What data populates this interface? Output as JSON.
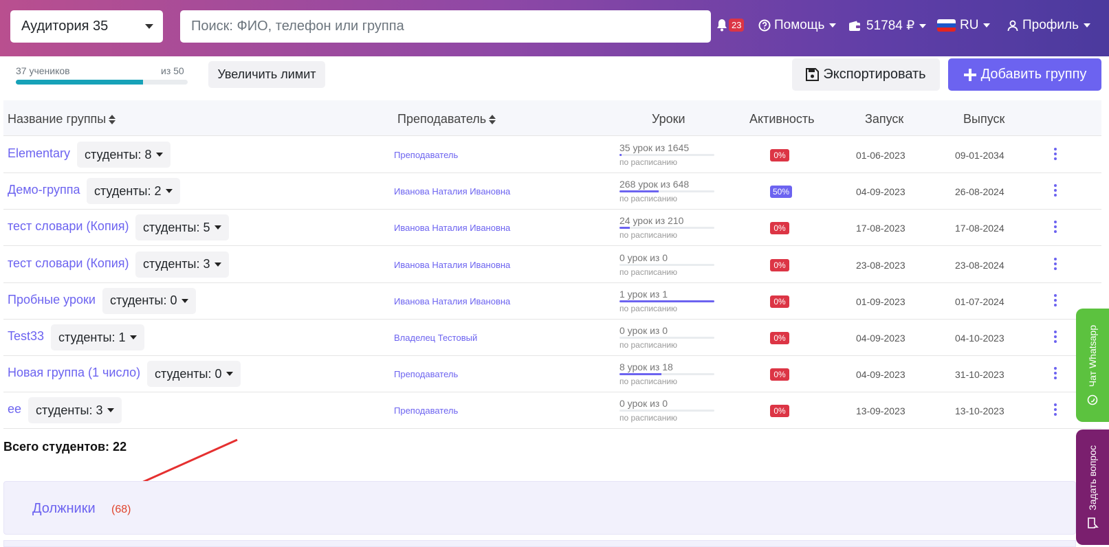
{
  "header": {
    "classroom_select": "Аудитория 35",
    "search_placeholder": "Поиск: ФИО, телефон или группа",
    "notifications_count": "23",
    "help_label": "Помощь",
    "balance": "51784 ₽",
    "language": "RU",
    "profile_label": "Профиль"
  },
  "limits": {
    "students_label": "37 учеников",
    "max_label": "из 50",
    "fill_fraction": 0.74,
    "increase_button": "Увеличить лимит"
  },
  "actions": {
    "export_label": "Экспортировать",
    "add_group_label": "Добавить группу"
  },
  "table": {
    "headers": {
      "name": "Название группы",
      "teacher": "Преподаватель",
      "lessons": "Уроки",
      "activity": "Активность",
      "start": "Запуск",
      "end": "Выпуск"
    },
    "rows": [
      {
        "name": "Elementary",
        "students": "студенты: 8",
        "teacher": "Преподаватель",
        "lessons": "35 урок из 1645",
        "lessons_fraction": 0.02,
        "schedule": "по расписанию",
        "activity": "0%",
        "start": "01-06-2023",
        "end": "09-01-2034"
      },
      {
        "name": "Демо-группа",
        "students": "студенты: 2",
        "teacher": "Иванова Наталия Ивановна",
        "lessons": "268 урок из 648",
        "lessons_fraction": 0.41,
        "schedule": "по расписанию",
        "activity": "50%",
        "start": "04-09-2023",
        "end": "26-08-2024"
      },
      {
        "name": "тест словари (Копия)",
        "students": "студенты: 5",
        "teacher": "Иванова Наталия Ивановна",
        "lessons": "24 урок из 210",
        "lessons_fraction": 0.11,
        "schedule": "по расписанию",
        "activity": "0%",
        "start": "17-08-2023",
        "end": "17-08-2024"
      },
      {
        "name": "тест словари (Копия)",
        "students": "студенты: 3",
        "teacher": "Иванова Наталия Ивановна",
        "lessons": "0 урок из 0",
        "lessons_fraction": 0,
        "schedule": "по расписанию",
        "activity": "0%",
        "start": "23-08-2023",
        "end": "23-08-2024"
      },
      {
        "name": "Пробные уроки",
        "students": "студенты: 0",
        "teacher": "Иванова Наталия Ивановна",
        "lessons": "1 урок из 1",
        "lessons_fraction": 1,
        "schedule": "по расписанию",
        "activity": "0%",
        "start": "01-09-2023",
        "end": "01-07-2024"
      },
      {
        "name": "Test33",
        "students": "студенты: 1",
        "teacher": "Владелец Тестовый",
        "lessons": "0 урок из 0",
        "lessons_fraction": 0,
        "schedule": "по расписанию",
        "activity": "0%",
        "start": "04-09-2023",
        "end": "04-10-2023"
      },
      {
        "name": "Новая группа (1 число)",
        "students": "студенты: 0",
        "teacher": "Преподаватель",
        "lessons": "8 урок из 18",
        "lessons_fraction": 0.44,
        "schedule": "по расписанию",
        "activity": "0%",
        "start": "04-09-2023",
        "end": "31-10-2023"
      },
      {
        "name": "ее",
        "students": "студенты: 3",
        "teacher": "Преподаватель",
        "lessons": "0 урок из 0",
        "lessons_fraction": 0,
        "schedule": "по расписанию",
        "activity": "0%",
        "start": "13-09-2023",
        "end": "13-10-2023"
      }
    ]
  },
  "total_students": "Всего студентов: 22",
  "debtors": {
    "label": "Должники",
    "count": "(68)"
  },
  "side_tabs": {
    "whatsapp": "Чат Whatsapp",
    "ask": "Задать вопрос"
  },
  "colors": {
    "accent": "#6c63f0",
    "danger": "#dc3545",
    "whatsapp": "#5cc23f",
    "ask": "#7a1f6e"
  }
}
